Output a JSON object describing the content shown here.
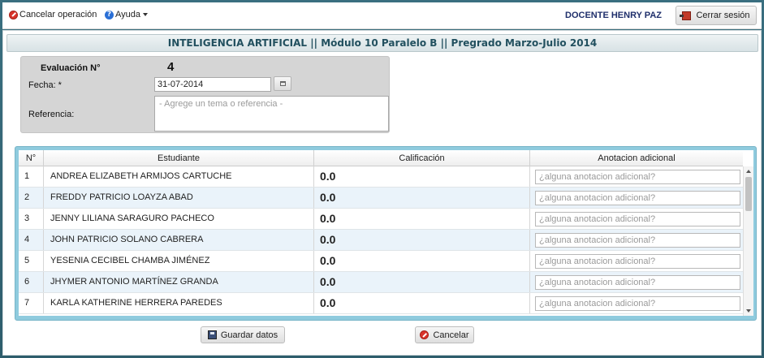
{
  "topbar": {
    "cancel_label": "Cancelar operación",
    "help_label": "Ayuda",
    "teacher_name": "DOCENTE HENRY PAZ",
    "logout_label": "Cerrar sesión"
  },
  "course_title": "INTELIGENCIA ARTIFICIAL || Módulo 10 Paralelo B || Pregrado Marzo-Julio 2014",
  "form": {
    "evaluation_label": "Evaluación N°",
    "evaluation_number": "4",
    "date_label": "Fecha:  *",
    "date_value": "31-07-2014",
    "reference_label": "Referencia:",
    "reference_placeholder": "- Agrege un tema o referencia -"
  },
  "table": {
    "headers": {
      "number": "N°",
      "student": "Estudiante",
      "grade": "Calificación",
      "note": "Anotacion adicional"
    },
    "note_placeholder": "¿alguna anotacion adicional?",
    "rows": [
      {
        "n": "1",
        "student": "ANDREA ELIZABETH ARMIJOS CARTUCHE",
        "grade": "0.0"
      },
      {
        "n": "2",
        "student": "FREDDY PATRICIO LOAYZA ABAD",
        "grade": "0.0"
      },
      {
        "n": "3",
        "student": "JENNY LILIANA SARAGURO PACHECO",
        "grade": "0.0"
      },
      {
        "n": "4",
        "student": "JOHN PATRICIO SOLANO CABRERA",
        "grade": "0.0"
      },
      {
        "n": "5",
        "student": "YESENIA CECIBEL CHAMBA JIMÉNEZ",
        "grade": "0.0"
      },
      {
        "n": "6",
        "student": "JHYMER ANTONIO MARTÍNEZ GRANDA",
        "grade": "0.0"
      },
      {
        "n": "7",
        "student": "KARLA KATHERINE HERRERA PAREDES",
        "grade": "0.0"
      }
    ]
  },
  "actions": {
    "save_label": "Guardar datos",
    "cancel_label": "Cancelar"
  }
}
